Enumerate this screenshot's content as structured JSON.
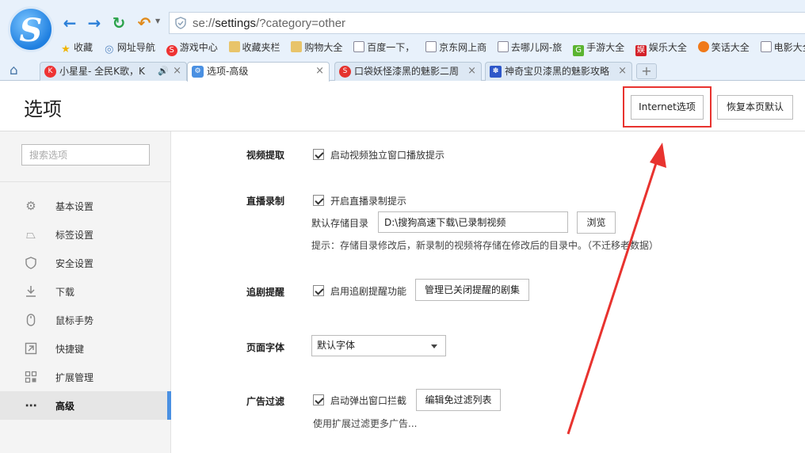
{
  "browser": {
    "logo_letter": "S",
    "url_prefix": "se://",
    "url_path": "settings",
    "url_query": "/?category=other",
    "bookmarks": [
      "收藏",
      "网址导航",
      "游戏中心",
      "收藏夹栏",
      "购物大全",
      "百度一下，",
      "京东网上商",
      "去哪儿网-旅",
      "手游大全",
      "娱乐大全",
      "笑话大全",
      "电影大全"
    ],
    "tabs": [
      {
        "label": "小星星- 全民K歌，K"
      },
      {
        "label": "选项-高级"
      },
      {
        "label": "口袋妖怪漆黑的魅影二周"
      },
      {
        "label": "神奇宝贝漆黑的魅影攻略"
      }
    ],
    "new_tab": "+"
  },
  "page": {
    "title": "选项",
    "internet_options": "Internet选项",
    "restore_defaults": "恢复本页默认"
  },
  "sidebar": {
    "search_placeholder": "搜索选项",
    "items": [
      {
        "label": "基本设置",
        "icon": "gear-icon"
      },
      {
        "label": "标签设置",
        "icon": "tab-icon"
      },
      {
        "label": "安全设置",
        "icon": "shield-icon"
      },
      {
        "label": "下载",
        "icon": "download-icon"
      },
      {
        "label": "鼠标手势",
        "icon": "mouse-icon"
      },
      {
        "label": "快捷键",
        "icon": "shortcut-icon"
      },
      {
        "label": "扩展管理",
        "icon": "extensions-icon"
      },
      {
        "label": "高级",
        "icon": "more-icon"
      }
    ]
  },
  "settings": {
    "video": {
      "label": "视频提取",
      "checkbox": "启动视频独立窗口播放提示"
    },
    "live": {
      "label": "直播录制",
      "checkbox": "开启直播录制提示",
      "dir_label": "默认存储目录",
      "dir_value": "D:\\搜狗高速下载\\已录制视频",
      "browse": "浏览",
      "hint": "提示：存储目录修改后，新录制的视频将存储在修改后的目录中。（不迁移老数据）"
    },
    "drama": {
      "label": "追剧提醒",
      "checkbox": "启用追剧提醒功能",
      "button": "管理已关闭提醒的剧集"
    },
    "font": {
      "label": "页面字体",
      "selected": "默认字体"
    },
    "adblock": {
      "label": "广告过滤",
      "checkbox": "启动弹出窗口拦截",
      "button": "编辑免过滤列表",
      "more": "使用扩展过滤更多广告..."
    }
  },
  "colors": {
    "annotation_red": "#e8332f",
    "active_accent": "#4a90e2"
  }
}
